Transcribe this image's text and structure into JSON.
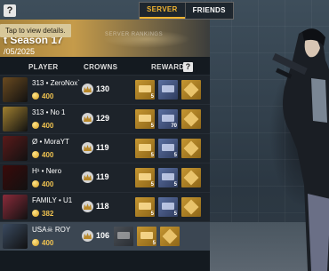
{
  "top": {
    "help_symbol": "?",
    "tooltip": "Tap to view details.",
    "tabs": [
      {
        "label": "SERVER",
        "active": true
      },
      {
        "label": "FRIENDS",
        "active": false
      }
    ]
  },
  "banner": {
    "title": "t Season 17",
    "date": "/05/2025",
    "subtitle": "SERVER RANKINGS"
  },
  "table": {
    "headers": {
      "player": "PLAYER",
      "crowns": "CROWNS",
      "reward": "REWARD",
      "reward_help": "?"
    },
    "rows": [
      {
        "name": "313 • ZeroNox`",
        "points": "400",
        "crowns": "130",
        "rewards": [
          "gold",
          "blue",
          "gold",
          "blue",
          "gold"
        ],
        "reward_counts": [
          "5",
          "",
          ""
        ],
        "avatar_color": "#6a4a20"
      },
      {
        "name": "313 • No 1",
        "points": "400",
        "crowns": "129",
        "rewards": [
          "gold",
          "blue",
          "gold"
        ],
        "reward_counts": [
          "5",
          "70",
          ""
        ],
        "avatar_color": "#a08030"
      },
      {
        "name": "Ø • MoraYT",
        "points": "400",
        "crowns": "119",
        "rewards": [
          "gold",
          "blue",
          "gold"
        ],
        "reward_counts": [
          "5",
          "5",
          ""
        ],
        "avatar_color": "#5a1a1a"
      },
      {
        "name": "H¹ • Nero",
        "points": "400",
        "crowns": "119",
        "rewards": [
          "gold",
          "blue",
          "gold"
        ],
        "reward_counts": [
          "5",
          "5",
          ""
        ],
        "avatar_color": "#3a0a0a"
      },
      {
        "name": "FAMILY • U1",
        "points": "382",
        "crowns": "118",
        "rewards": [
          "gold",
          "blue",
          "gold"
        ],
        "reward_counts": [
          "5",
          "5",
          ""
        ],
        "avatar_color": "#8a2b3a"
      },
      {
        "name": "USA☠ ROY",
        "points": "400",
        "crowns": "106",
        "rewards": [
          "grey",
          "gold",
          "gold"
        ],
        "reward_counts": [
          "",
          "5",
          ""
        ],
        "avatar_color": "#3a4a60",
        "mine": true
      }
    ]
  },
  "colors": {
    "accent": "#f2b531",
    "panel": "#141a20",
    "row": "#1d232a",
    "mine_row": "#3b4652"
  }
}
